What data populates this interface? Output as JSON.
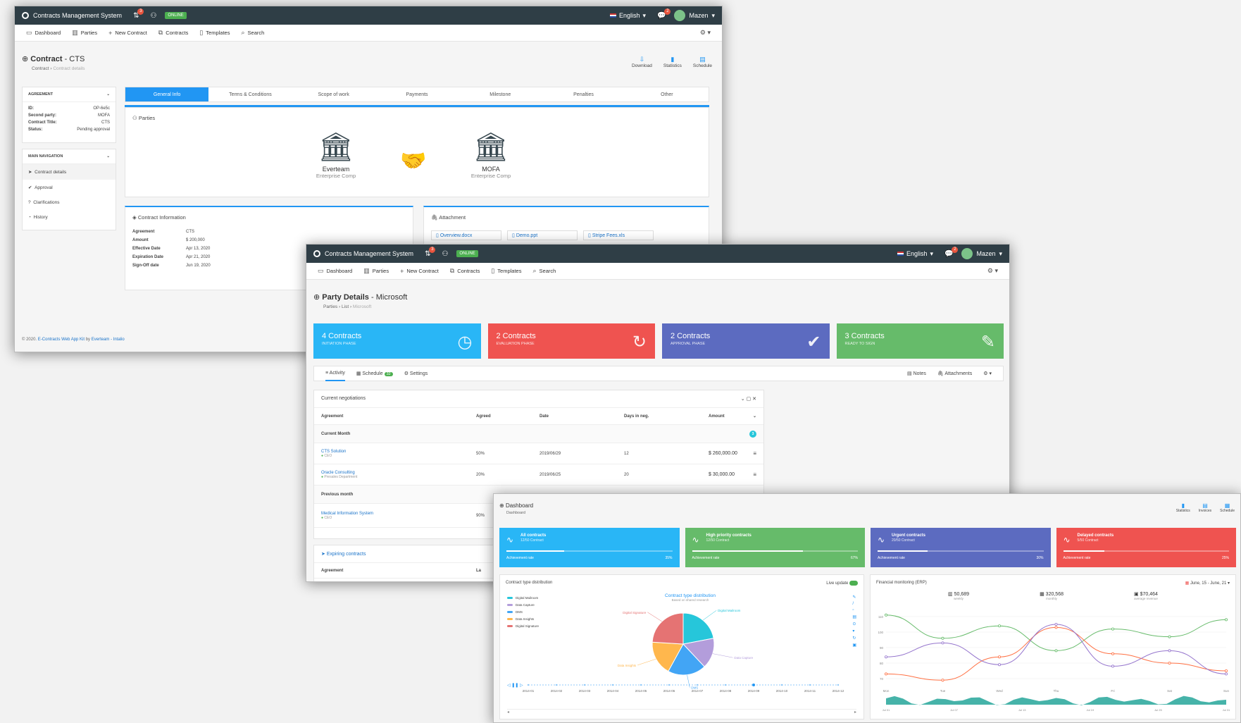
{
  "app": {
    "title": "Contracts Management System",
    "online": "ONLINE",
    "notif_count": "3",
    "chat_count": "2",
    "language": "English",
    "user": "Mazen"
  },
  "nav": [
    "Dashboard",
    "Parties",
    "New Contract",
    "Contracts",
    "Templates",
    "Search"
  ],
  "win1": {
    "title_bold": "Contract",
    "title_rest": " - CTS",
    "breadcrumb": [
      "Contract",
      "Contract details"
    ],
    "actions": [
      "Download",
      "Statistics",
      "Schedule"
    ],
    "agreement": {
      "heading": "AGREEMENT",
      "rows": [
        {
          "k": "ID:",
          "v": "OP-6e5c"
        },
        {
          "k": "Second party:",
          "v": "MOFA"
        },
        {
          "k": "Contract Title:",
          "v": "CTS"
        },
        {
          "k": "Status:",
          "v": "Pending approval"
        }
      ]
    },
    "mainnav": {
      "heading": "MAIN NAVIGATION",
      "items": [
        "Contract details",
        "Approval",
        "Clarifications",
        "History"
      ]
    },
    "tabs": [
      "General Info",
      "Terms & Conditions",
      "Scope of work",
      "Payments",
      "Milestone",
      "Penalties",
      "Other"
    ],
    "parties": {
      "heading": "Parties",
      "p1_name": "Everteam",
      "p1_sub": "Enterprise Comp",
      "p2_name": "MOFA",
      "p2_sub": "Enterprise Comp"
    },
    "contract_info": {
      "heading": "Contract Information",
      "rows": [
        {
          "k": "Agreement",
          "v": "CTS"
        },
        {
          "k": "Amount",
          "v": "$ 200,000"
        },
        {
          "k": "Effective Date",
          "v": "Apr 13, 2020"
        },
        {
          "k": "Expiration Date",
          "v": "Apr 21, 2020"
        },
        {
          "k": "Sign-Off date",
          "v": "Jun 19, 2020"
        }
      ]
    },
    "attachment": {
      "heading": "Attachment",
      "files": [
        "Overview.docx",
        "Demo.ppt",
        "Stripe Fees.xls"
      ]
    },
    "footer": {
      "prefix": "© 2020.",
      "link1": "E-Contracts Web App Kit",
      "by": "by",
      "link2": "Everteam - Intalio"
    }
  },
  "win2": {
    "title_bold": "Party Details",
    "title_rest": " - Microsoft",
    "breadcrumb": [
      "Parties",
      "List",
      "Microsoft"
    ],
    "tiles": [
      {
        "big": "4 Contracts",
        "sub": "INITIATION PHASE",
        "color": "#29b6f6",
        "icon": "timer-icon",
        "glyph": "◷"
      },
      {
        "big": "2 Contracts",
        "sub": "EVALUATION PHASE",
        "color": "#ef5350",
        "icon": "spinner-icon",
        "glyph": "↻"
      },
      {
        "big": "2 Contracts",
        "sub": "APPROVAL PHASE",
        "color": "#5c6bc0",
        "icon": "check-icon",
        "glyph": "✔"
      },
      {
        "big": "3 Contracts",
        "sub": "READY TO SIGN",
        "color": "#66bb6a",
        "icon": "feather-icon",
        "glyph": "✎"
      }
    ],
    "subtabs": {
      "activity": "Activity",
      "schedule": "Schedule",
      "schedule_count": "32",
      "settings": "Settings",
      "notes": "Notes",
      "attachments": "Attachments"
    },
    "negotiations": {
      "heading": "Current negotiations",
      "columns": [
        "Agreement",
        "Agreed",
        "Date",
        "Days in neg.",
        "Amount"
      ],
      "group1": "Current Month",
      "group1_count": "3",
      "rows": [
        {
          "name": "CTS Solution",
          "sub": "CEO",
          "agreed": "50%",
          "date": "2019/06/29",
          "days": "12",
          "amount": "$ 260,000.00"
        },
        {
          "name": "Oracle Consulting",
          "sub": "Presales Department",
          "agreed": "20%",
          "date": "2019/06/25",
          "days": "20",
          "amount": "$ 30,000.00"
        }
      ],
      "group2": "Previous month",
      "prev_rows": [
        {
          "name": "Medical Information System",
          "sub": "CEO",
          "agreed": "90%"
        }
      ]
    },
    "expiring": {
      "heading": "Expiring contracts",
      "col1": "Agreement",
      "col2": "La"
    }
  },
  "win3": {
    "title": "Dashboard",
    "breadcrumb": "Dashboard",
    "actions": [
      "Statistics",
      "Invoices",
      "Schedule"
    ],
    "tiles": [
      {
        "t1": "All contracts",
        "t2": "12/50 Contract",
        "rate_label": "Achievement rate",
        "rate": "35%",
        "fill": 0.35,
        "color": "#29b6f6"
      },
      {
        "t1": "High priority contracts",
        "t2": "12/50 Contract",
        "rate_label": "Achievement rate",
        "rate": "67%",
        "fill": 0.67,
        "color": "#66bb6a"
      },
      {
        "t1": "Urgent contracts",
        "t2": "20/50 Contract",
        "rate_label": "Achievement rate",
        "rate": "30%",
        "fill": 0.3,
        "color": "#5c6bc0"
      },
      {
        "t1": "Delayed contracts",
        "t2": "5/50 Contract",
        "rate_label": "Achievement rate",
        "rate": "25%",
        "fill": 0.25,
        "color": "#ef5350"
      }
    ],
    "pie_panel": {
      "heading": "Contract type distribution",
      "live": "Live update",
      "chart_title": "Contract type distribution",
      "chart_sub": "Based on shared research",
      "legend": [
        "Digital Mailroom",
        "Data Capture",
        "DMS",
        "Data Insights",
        "Digital Signature"
      ],
      "timeline": [
        "2014-01",
        "2014-02",
        "2014-03",
        "2014-04",
        "2014-05",
        "2014-06",
        "2014-07",
        "2014-08",
        "2014-09",
        "2014-10",
        "2014-11",
        "2014-12"
      ]
    },
    "finance_panel": {
      "heading": "Financial monitoring (ERP)",
      "range": "June, 15 - June, 21",
      "stats": [
        {
          "v": "50,689",
          "l": "weekly"
        },
        {
          "v": "320,568",
          "l": "monthly"
        },
        {
          "v": "$70,464",
          "l": "average revenue"
        }
      ],
      "y_ticks": [
        "110",
        "100",
        "90",
        "80",
        "70"
      ],
      "x_ticks": [
        "Mon",
        "Tue",
        "Wed",
        "Thu",
        "Fri",
        "Sat",
        "Sun"
      ],
      "brush_ticks": [
        "Jul 01",
        "Jul 07",
        "Jul 13",
        "Jul 19",
        "Jul 25",
        "Jul 31"
      ]
    },
    "chart_data": [
      {
        "type": "pie",
        "title": "Contract type distribution",
        "subtitle": "Based on shared research",
        "categories": [
          "Digital Mailroom",
          "Data Capture",
          "DMS",
          "Data Insights",
          "Digital Signature"
        ],
        "values": [
          22,
          16,
          20,
          18,
          24
        ],
        "colors": [
          "#26c6da",
          "#b39ddb",
          "#42a5f5",
          "#ffb74d",
          "#e57373"
        ]
      },
      {
        "type": "line",
        "categories": [
          "Mon",
          "Tue",
          "Wed",
          "Thu",
          "Fri",
          "Sat",
          "Sun"
        ],
        "ylim": [
          65,
          115
        ],
        "series": [
          {
            "values": [
              111,
              96,
              104,
              88,
              102,
              97,
              108
            ],
            "color": "#66bb6a"
          },
          {
            "values": [
              73,
              69,
              84,
              103,
              86,
              80,
              75
            ],
            "color": "#ff7043"
          },
          {
            "values": [
              84,
              93,
              79,
              105,
              78,
              88,
              73
            ],
            "color": "#9575cd"
          }
        ]
      }
    ]
  }
}
